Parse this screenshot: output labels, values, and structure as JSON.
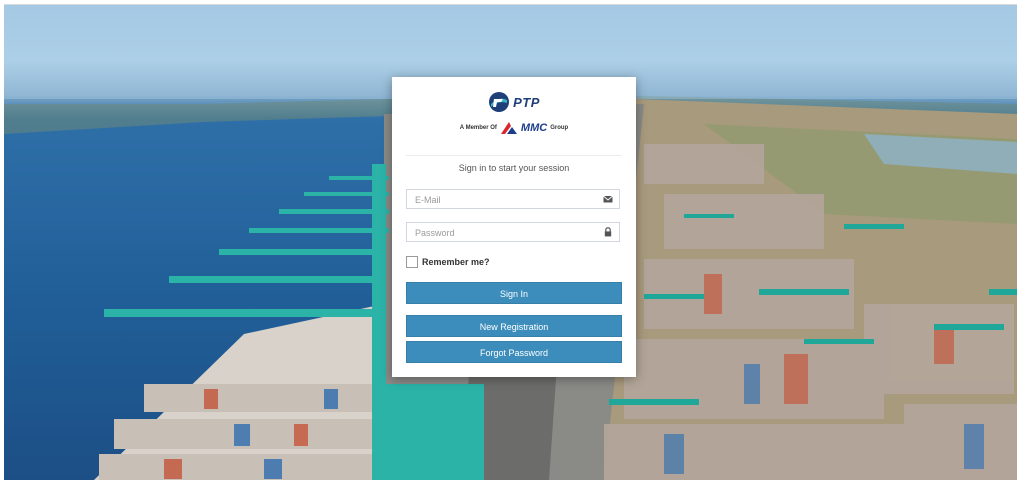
{
  "brand": {
    "logo_text": "PTP",
    "member_of": "A Member Of",
    "group_logo_text": "MMC",
    "group_suffix": "Group"
  },
  "login": {
    "session_message": "Sign in to start your session",
    "email_placeholder": "E-Mail",
    "password_placeholder": "Password",
    "remember_label": "Remember me?",
    "signin_label": "Sign In",
    "register_label": "New Registration",
    "forgot_label": "Forgot Password"
  },
  "icons": {
    "email": "envelope-icon",
    "password": "lock-icon",
    "logo": "ptp-logo-icon",
    "group": "mmc-logo-icon"
  },
  "colors": {
    "button": "#3c8dbc",
    "brand_navy": "#1f3f78",
    "crane_teal": "#2bb3a8"
  },
  "background": {
    "description_icon": "container-port-photo"
  }
}
